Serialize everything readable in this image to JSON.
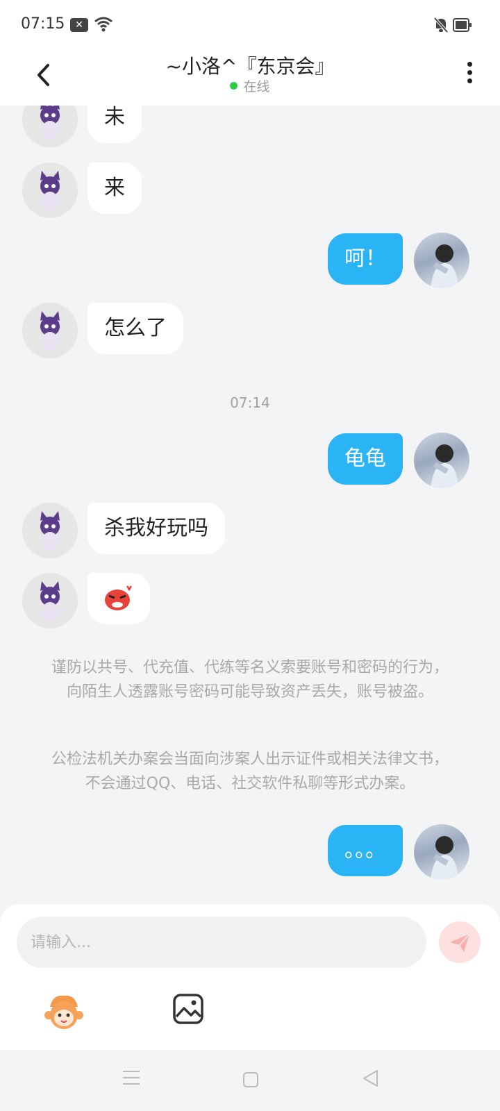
{
  "status_bar": {
    "time": "07:15"
  },
  "header": {
    "title": "~小洛^『东京会』",
    "status": "在线",
    "status_color": "#2ecc40"
  },
  "messages": [
    {
      "from": "them",
      "text": "未"
    },
    {
      "from": "them",
      "text": "来"
    },
    {
      "from": "me",
      "text": "呵！"
    },
    {
      "from": "them",
      "text": "怎么了"
    },
    {
      "timestamp": "07:14"
    },
    {
      "from": "me",
      "text": "龟龟"
    },
    {
      "from": "them",
      "text": "杀我好玩吗"
    },
    {
      "from": "them",
      "sticker": "angry-face-sticker"
    },
    {
      "from": "me",
      "text": "。。。"
    }
  ],
  "notice": {
    "line1": "谨防以共号、代充值、代练等名义索要账号和密码的行为，向陌生人透露账号密码可能导致资产丢失，账号被盗。",
    "line2": "公检法机关办案会当面向涉案人出示证件或相关法律文书，不会通过QQ、电话、社交软件私聊等形式办案。"
  },
  "input": {
    "placeholder": "请输入..."
  },
  "colors": {
    "my_bubble": "#2ab3f5",
    "their_bubble": "#ffffff",
    "background": "#f3f4f6"
  }
}
